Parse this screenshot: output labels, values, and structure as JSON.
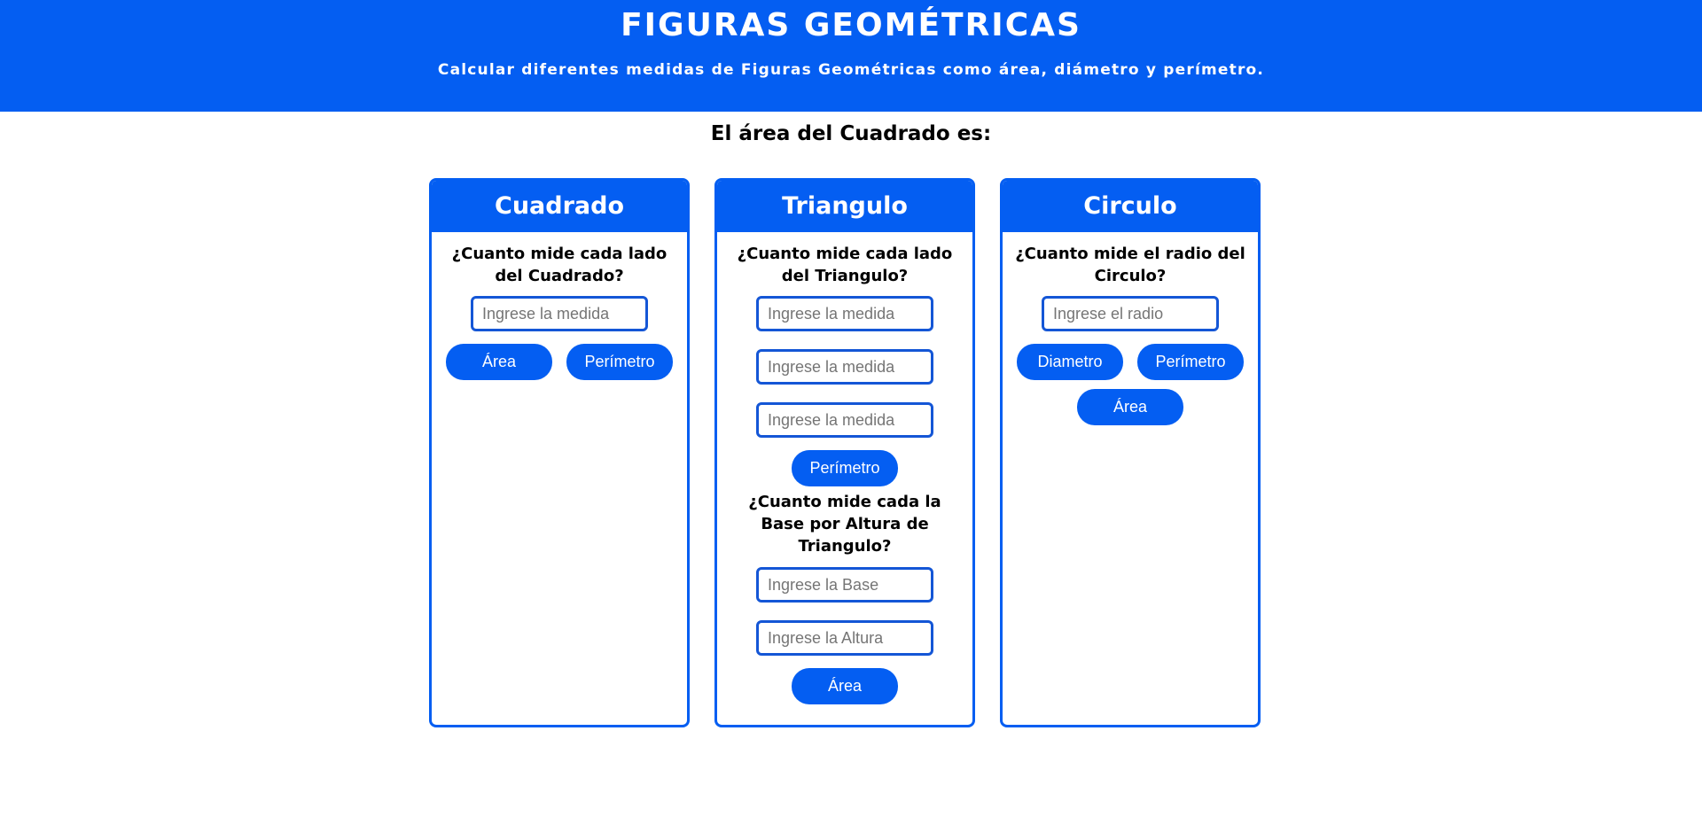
{
  "header": {
    "title": "FIGURAS GEOMÉTRICAS",
    "subtitle": "Calcular diferentes medidas de Figuras Geométricas como área, diámetro y perímetro."
  },
  "result_text": "El área del Cuadrado es:",
  "colors": {
    "accent": "#045ef2",
    "input_border": "#1456d6"
  },
  "cuadrado": {
    "title": "Cuadrado",
    "question": "¿Cuanto mide cada lado del Cuadrado?",
    "input_placeholder": "Ingrese la medida",
    "area_label": "Área",
    "perimetro_label": "Perímetro"
  },
  "triangulo": {
    "title": "Triangulo",
    "question_sides": "¿Cuanto mide cada lado del Triangulo?",
    "side_placeholder": "Ingrese la medida",
    "perimetro_label": "Perímetro",
    "question_base_altura": "¿Cuanto mide cada la Base por Altura de Triangulo?",
    "base_placeholder": "Ingrese la Base",
    "altura_placeholder": "Ingrese la Altura",
    "area_label": "Área"
  },
  "circulo": {
    "title": "Circulo",
    "question": "¿Cuanto mide el radio del Circulo?",
    "input_placeholder": "Ingrese el radio",
    "diametro_label": "Diametro",
    "perimetro_label": "Perímetro",
    "area_label": "Área"
  }
}
